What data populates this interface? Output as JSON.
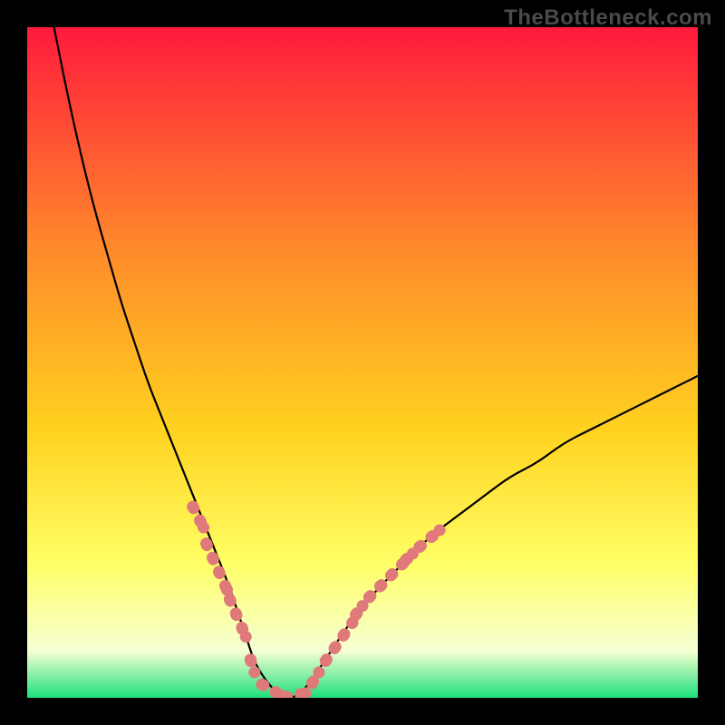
{
  "watermark": "TheBottleneck.com",
  "colors": {
    "gradient_top": "#ff1a3c",
    "gradient_mid1": "#ff6a2b",
    "gradient_mid2": "#ffd21f",
    "gradient_mid3": "#ffff66",
    "gradient_mid4": "#f6ffd3",
    "gradient_bottom": "#1ee07a",
    "curve": "#000000",
    "accent_dots": "#e07a7a"
  },
  "chart_data": {
    "type": "line",
    "title": "",
    "xlabel": "",
    "ylabel": "",
    "xlim": [
      0,
      100
    ],
    "ylim": [
      0,
      100
    ],
    "series": [
      {
        "name": "bottleneck-curve",
        "x": [
          4,
          6,
          8,
          10,
          12,
          14,
          16,
          18,
          20,
          22,
          24,
          26,
          28,
          30,
          32,
          33,
          34,
          36,
          38,
          40,
          42,
          44,
          46,
          48,
          52,
          56,
          60,
          64,
          68,
          72,
          76,
          80,
          84,
          88,
          92,
          96,
          100
        ],
        "y": [
          100,
          90,
          81,
          73,
          66,
          59,
          53,
          47,
          42,
          37,
          32,
          27,
          22,
          17,
          11,
          8,
          5,
          2,
          0,
          0,
          2,
          5,
          8,
          11,
          16,
          20,
          24,
          27,
          30,
          33,
          35,
          38,
          40,
          42,
          44,
          46,
          48
        ]
      }
    ],
    "accent_segments": [
      {
        "x": [
          24.7,
          26.3
        ],
        "y": [
          28.5,
          25.4
        ]
      },
      {
        "x": [
          26.7,
          29.8
        ],
        "y": [
          23.0,
          16.1
        ]
      },
      {
        "x": [
          30.2,
          32.6
        ],
        "y": [
          14.7,
          9.1
        ]
      },
      {
        "x": [
          33.3,
          33.9
        ],
        "y": [
          5.7,
          3.8
        ]
      },
      {
        "x": [
          35.0,
          38.0
        ],
        "y": [
          2.0,
          0.3
        ]
      },
      {
        "x": [
          38.5,
          41.5
        ],
        "y": [
          0.1,
          0.7
        ]
      },
      {
        "x": [
          42.5,
          43.5
        ],
        "y": [
          2.2,
          3.8
        ]
      },
      {
        "x": [
          44.5,
          48.5
        ],
        "y": [
          5.5,
          11.2
        ]
      },
      {
        "x": [
          49.0,
          50.0
        ],
        "y": [
          12.4,
          13.7
        ]
      },
      {
        "x": [
          51.0,
          56.0
        ],
        "y": [
          15.0,
          20.0
        ]
      },
      {
        "x": [
          56.5,
          57.5
        ],
        "y": [
          20.6,
          21.5
        ]
      },
      {
        "x": [
          58.5,
          61.5
        ],
        "y": [
          22.5,
          25.0
        ]
      }
    ]
  }
}
